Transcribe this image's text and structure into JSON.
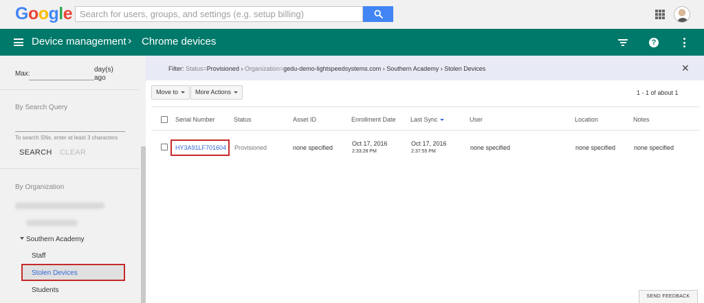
{
  "google": {
    "logo_letters": [
      {
        "ch": "G",
        "color": "#4285f4"
      },
      {
        "ch": "o",
        "color": "#ea4335"
      },
      {
        "ch": "o",
        "color": "#fbbc05"
      },
      {
        "ch": "g",
        "color": "#4285f4"
      },
      {
        "ch": "l",
        "color": "#34a853"
      },
      {
        "ch": "e",
        "color": "#ea4335"
      }
    ],
    "search_placeholder": "Search for users, groups, and settings (e.g. setup billing)"
  },
  "appbar": {
    "section": "Device management",
    "separator": "›",
    "page": "Chrome devices",
    "color": "#00796b"
  },
  "sidebar": {
    "max_label": "Max:",
    "max_unit_line1": "day(s)",
    "max_unit_line2": "ago",
    "max_value": "",
    "search_query_heading": "By Search Query",
    "search_query_value": "",
    "search_hint": "To search SNs, enter at least 3 characters",
    "search_button": "SEARCH",
    "clear_button": "CLEAR",
    "org_heading": "By Organization",
    "org_tree": {
      "parent": "Southern Academy",
      "children": [
        "Staff",
        "Stolen Devices",
        "Students"
      ],
      "selected": "Stolen Devices"
    }
  },
  "filter": {
    "label": "Filter:",
    "status_key": "Status=",
    "status_value": "Provisioned",
    "sep1": " › ",
    "org_key": "Organization=",
    "org_value": "gedu-demo-lightspeedsystems.com › Southern Academy › Stolen Devices",
    "close": "✕"
  },
  "toolbar": {
    "move_to": "Move to",
    "more_actions": "More Actions",
    "pager": "1 - 1 of about 1"
  },
  "table": {
    "columns": [
      "Serial Number",
      "Status",
      "Asset ID",
      "Enrollment Date",
      "Last Sync",
      "User",
      "Location",
      "Notes"
    ],
    "sorted_column": "Last Sync",
    "rows": [
      {
        "serial": "HY3A91LF701604",
        "status": "Provisioned",
        "asset_id": "none specified",
        "enroll_date": "Oct 17, 2016",
        "enroll_time": "2:33:28 PM",
        "sync_date": "Oct 17, 2016",
        "sync_time": "2:37:55 PM",
        "user": "none specified",
        "location": "none specified",
        "notes": "none specified"
      }
    ]
  },
  "feedback": "SEND FEEDBACK",
  "colors": {
    "accent": "#4285f4",
    "link": "#3367d6",
    "highlight_border": "#c62828"
  }
}
